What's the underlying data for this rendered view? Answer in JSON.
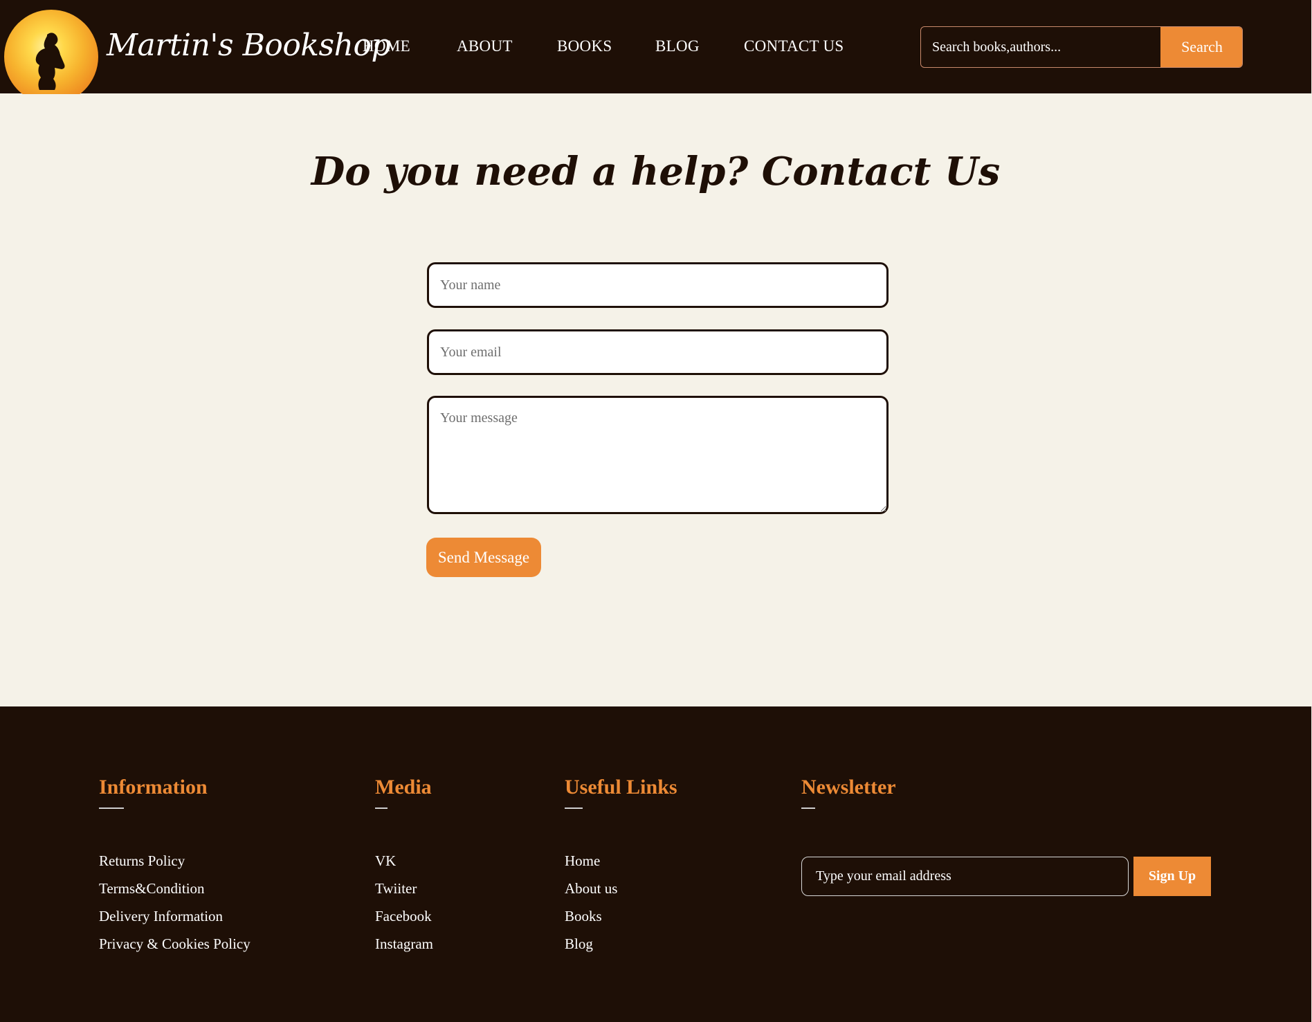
{
  "brand": {
    "name": "Martin's Bookshop",
    "logo_icon": "reader-silhouette-sun-logo"
  },
  "nav": {
    "items": [
      {
        "label": "HOME"
      },
      {
        "label": "ABOUT"
      },
      {
        "label": "BOOKS"
      },
      {
        "label": "BLOG"
      },
      {
        "label": "CONTACT US"
      }
    ]
  },
  "search": {
    "placeholder": "Search books,authors...",
    "button_label": "Search"
  },
  "contact": {
    "title": "Do you need a help? Contact Us",
    "name_placeholder": "Your name",
    "email_placeholder": "Your email",
    "message_placeholder": "Your message",
    "send_label": "Send Message"
  },
  "footer": {
    "information": {
      "title": "Information",
      "links": [
        "Returns Policy",
        "Terms&Condition",
        "Delivery Information",
        "Privacy & Cookies Policy"
      ]
    },
    "media": {
      "title": "Media",
      "links": [
        "VK",
        "Twiiter",
        "Facebook",
        "Instagram"
      ]
    },
    "useful_links": {
      "title": "Useful Links",
      "links": [
        "Home",
        "About us",
        "Books",
        "Blog"
      ]
    },
    "newsletter": {
      "title": "Newsletter",
      "email_placeholder": "Type your email address",
      "signup_label": "Sign Up"
    }
  },
  "colors": {
    "dark_brown": "#1e0f06",
    "accent_orange": "#ed8a35",
    "cream": "#f5f2e8"
  }
}
